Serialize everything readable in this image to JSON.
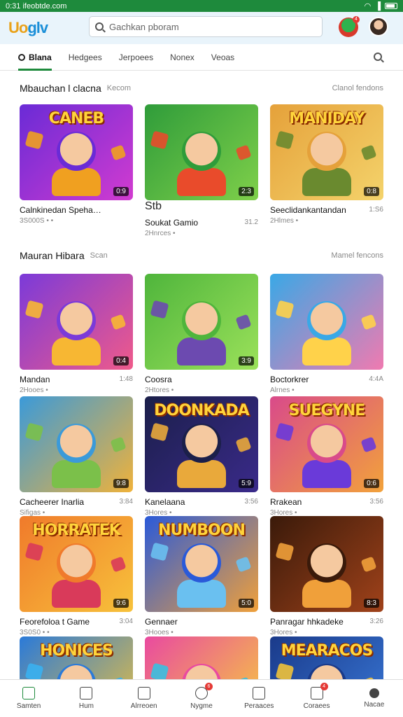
{
  "status": {
    "time": "0:31 ifeobtde.com",
    "icons": [
      "wifi-icon",
      "signal-icon",
      "battery-icon"
    ]
  },
  "app": {
    "logo_a": "Uo",
    "logo_b": "glv",
    "search_placeholder": "Gachkan pboram",
    "mascot_badge": "4"
  },
  "tabs": [
    {
      "label": "Blana",
      "active": true
    },
    {
      "label": "Hedgees"
    },
    {
      "label": "Jerpoees"
    },
    {
      "label": "Nonex"
    },
    {
      "label": "Veoas"
    }
  ],
  "sections": [
    {
      "title": "Mbauchan l clacna",
      "subtitle": "Kecom",
      "see_all": "Clanol fendons"
    },
    {
      "title": "Mauran Hibara",
      "subtitle": "Scan",
      "see_all": "Mamel fencons"
    }
  ],
  "cards": [
    {
      "title": "Calnkinedan Spehanjo",
      "meta": "3S000S • •",
      "count": "",
      "duration": "0:9",
      "art": "CANEB",
      "tag": ""
    },
    {
      "title": "Soukat Gamio",
      "meta": "2Hnrces •",
      "count": "31.2",
      "duration": "2:3",
      "art": "",
      "tag": "Stb"
    },
    {
      "title": "Seeclidankantandan",
      "meta": "2Hlmes •",
      "count": "1:S6",
      "duration": "0:8",
      "art": "MANIDAY",
      "tag": ""
    },
    {
      "title": "Mandan",
      "meta": "2Hooes •",
      "count": "1:48",
      "duration": "0:4",
      "art": "",
      "tag": ""
    },
    {
      "title": "Coosra",
      "meta": "2Htores •",
      "count": "",
      "duration": "3:9",
      "art": "",
      "tag": ""
    },
    {
      "title": "Boctorkrer",
      "meta": "Alrnes •",
      "count": "4:4A",
      "duration": "",
      "art": "",
      "tag": ""
    },
    {
      "title": "Cacheerer Inarlia",
      "meta": "Sifigas •",
      "count": "3:84",
      "duration": "9:8",
      "art": "",
      "tag": ""
    },
    {
      "title": "Kanelaana",
      "meta": "3Hores •",
      "count": "3:56",
      "duration": "5:9",
      "art": "DOONKADA",
      "tag": ""
    },
    {
      "title": "Rrakean",
      "meta": "3Hores •",
      "count": "3:56",
      "duration": "0:6",
      "art": "SUEGYNE",
      "tag": ""
    },
    {
      "title": "Feorefoloa t Game",
      "meta": "3S0S0 • •",
      "count": "3:04",
      "duration": "9:6",
      "art": "HORRATEK",
      "tag": ""
    },
    {
      "title": "Gennaer",
      "meta": "3Hooes •",
      "count": "",
      "duration": "5:0",
      "art": "NUMBOON",
      "tag": ""
    },
    {
      "title": "Panragar hhkadeke",
      "meta": "3Hores •",
      "count": "3:26",
      "duration": "8:3",
      "art": "",
      "tag": ""
    },
    {
      "title": "",
      "meta": "",
      "count": "",
      "duration": "",
      "art": "HONICES",
      "tag": ""
    },
    {
      "title": "",
      "meta": "",
      "count": "",
      "duration": "",
      "art": "",
      "tag": ""
    },
    {
      "title": "",
      "meta": "",
      "count": "",
      "duration": "",
      "art": "MEARACOS",
      "tag": ""
    }
  ],
  "bottom_nav": [
    {
      "label": "Samten",
      "icon": "home-icon",
      "badge": ""
    },
    {
      "label": "Hum",
      "icon": "grid-icon",
      "badge": ""
    },
    {
      "label": "Alrreoen",
      "icon": "house-icon",
      "badge": ""
    },
    {
      "label": "Nygme",
      "icon": "check-icon",
      "badge": "6"
    },
    {
      "label": "Peraaces",
      "icon": "list-icon",
      "badge": ""
    },
    {
      "label": "Coraees",
      "icon": "apps-icon",
      "badge": "4"
    },
    {
      "label": "Nacae",
      "icon": "profile-icon",
      "badge": ""
    }
  ],
  "colors": {
    "accent": "#1e8a3c",
    "appbar": "#e9f4fb"
  }
}
